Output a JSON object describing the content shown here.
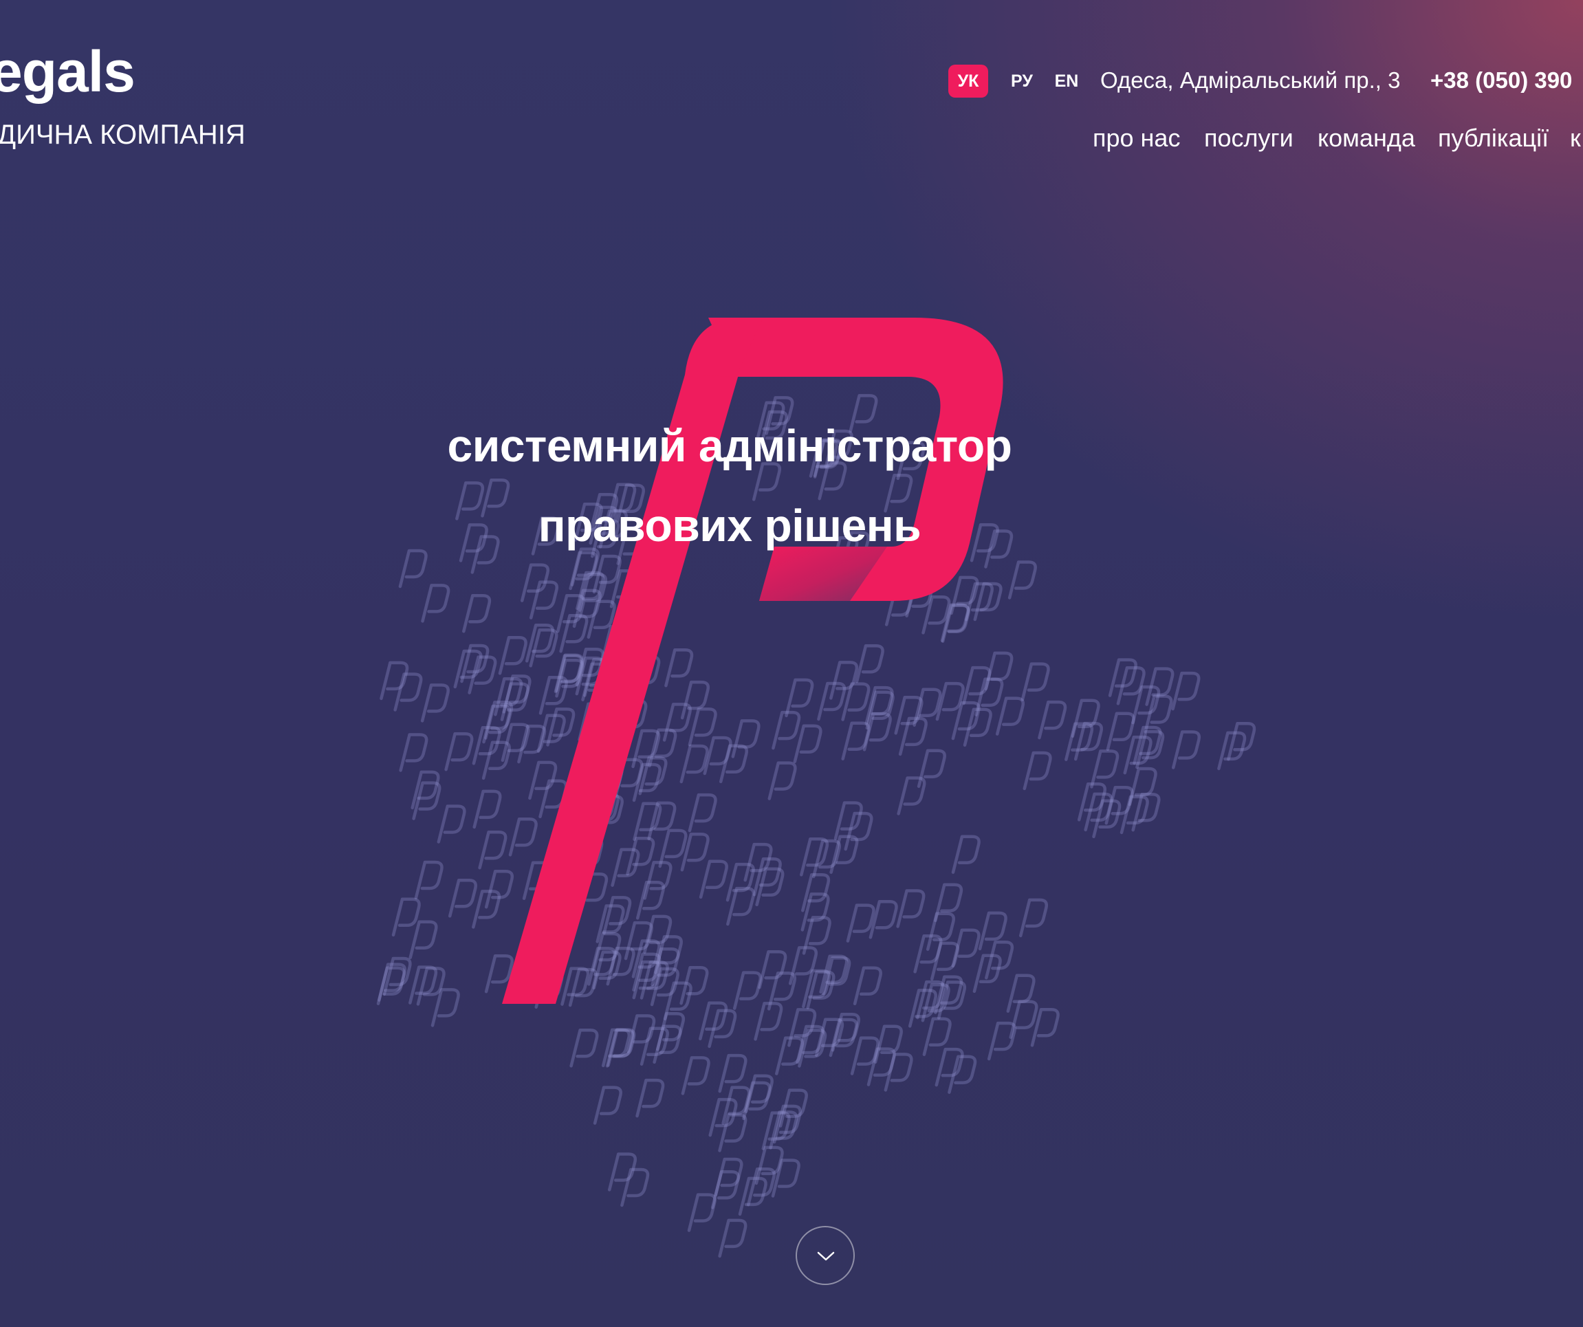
{
  "brand": {
    "name": "egals",
    "tagline": "ДИЧНА КОМПАНІЯ"
  },
  "languages": [
    {
      "label": "УК",
      "active": true
    },
    {
      "label": "РУ",
      "active": false
    },
    {
      "label": "EN",
      "active": false
    }
  ],
  "contact": {
    "address": "Одеса, Адміральський пр., 3",
    "phone": "+38 (050) 390"
  },
  "nav": {
    "items": [
      "про нас",
      "послуги",
      "команда",
      "публікації",
      "к"
    ]
  },
  "hero": {
    "headline_line1": "системний адміністратор",
    "headline_line2": "правових рішень"
  },
  "icons": {
    "logo_mark": "p-logo-mark",
    "pattern": "p-pattern",
    "scroll": "chevron-down-icon"
  },
  "colors": {
    "accent": "#ef1c5d",
    "background": "#343264",
    "gradient_warm": "#98425e",
    "text": "#ffffff"
  }
}
